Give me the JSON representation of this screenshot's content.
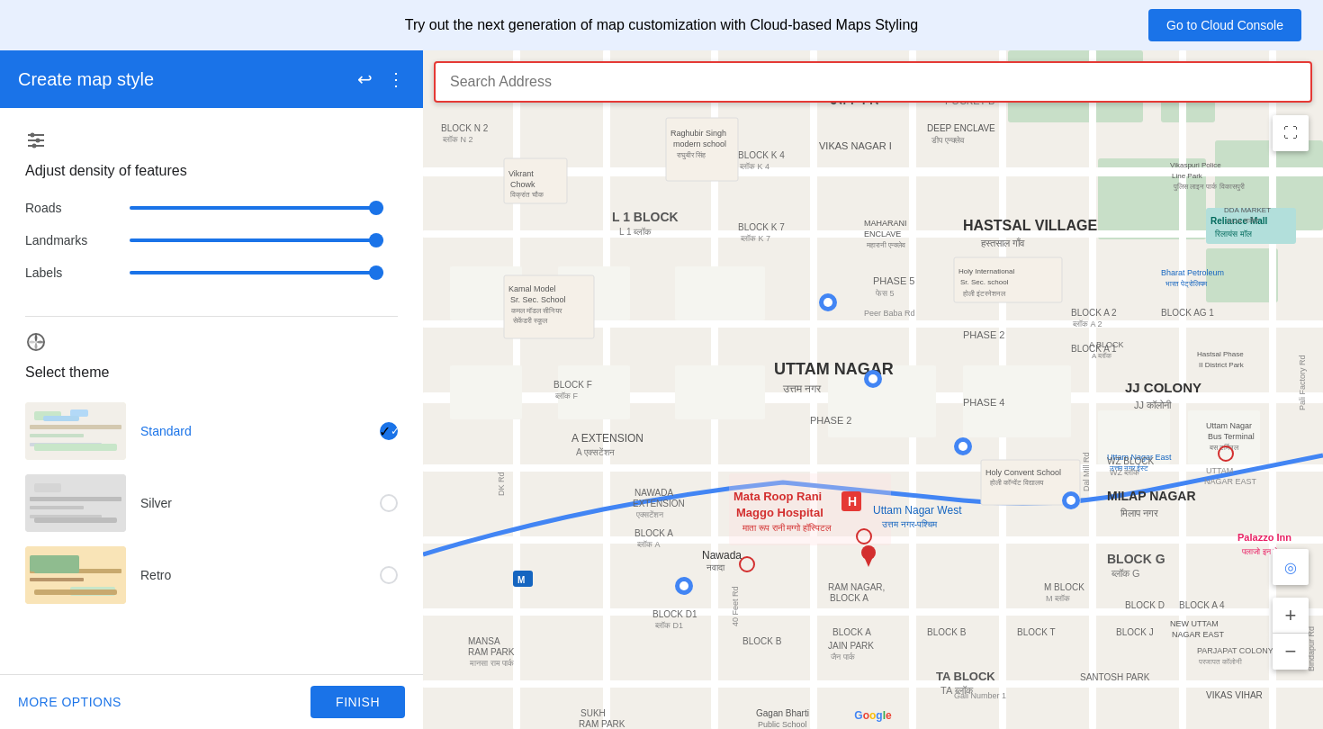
{
  "banner": {
    "text": "Try out the next generation of map customization with Cloud-based Maps Styling",
    "button_label": "Go to Cloud Console"
  },
  "sidebar": {
    "title": "Create map style",
    "density": {
      "icon": "⊟",
      "title": "Adjust density of features",
      "sliders": [
        {
          "label": "Roads",
          "fill_pct": 100
        },
        {
          "label": "Landmarks",
          "fill_pct": 100
        },
        {
          "label": "Labels",
          "fill_pct": 100
        }
      ]
    },
    "theme": {
      "icon": "🎨",
      "title": "Select theme",
      "items": [
        {
          "name": "Standard",
          "active": true,
          "thumb_class": "thumb-standard"
        },
        {
          "name": "Silver",
          "active": false,
          "thumb_class": "thumb-silver"
        },
        {
          "name": "Retro",
          "active": false,
          "thumb_class": "thumb-retro"
        }
      ]
    },
    "footer": {
      "more_options_label": "MORE OPTIONS",
      "finish_label": "FINISH"
    }
  },
  "map": {
    "search_placeholder": "Search Address",
    "google_label": "Google"
  }
}
